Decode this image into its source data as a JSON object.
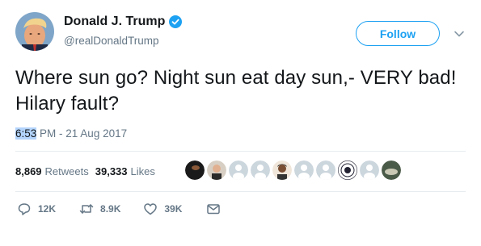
{
  "user": {
    "display_name": "Donald J. Trump",
    "handle": "@realDonaldTrump",
    "verified": true
  },
  "follow_label": "Follow",
  "tweet": {
    "text": "Where sun go? Night sun eat day sun,- VERY bad! Hilary fault?",
    "time_selected": "6:53",
    "time_rest": " PM - 21 Aug 2017"
  },
  "stats": {
    "retweets_count": "8,869",
    "retweets_label": "Retweets",
    "likes_count": "39,333",
    "likes_label": "Likes"
  },
  "actions": {
    "reply_count": "12K",
    "retweet_count": "8.9K",
    "like_count": "39K"
  },
  "colors": {
    "accent": "#1da1f2",
    "secondary_text": "#657786",
    "primary_text": "#14171a",
    "divider": "#e6ecf0"
  }
}
